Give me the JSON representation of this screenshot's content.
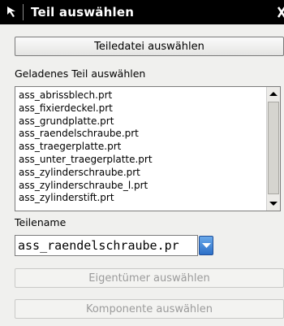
{
  "window": {
    "title": "Teil auswählen",
    "icon": "arrow-cursor-icon",
    "close_icon": "close-icon"
  },
  "buttons": {
    "select_part_file": "Teiledatei auswählen",
    "select_owner": "Eigentümer auswählen",
    "select_component": "Komponente auswählen"
  },
  "loaded_parts": {
    "label": "Geladenes Teil auswählen",
    "items": [
      "ass_abrissblech.prt",
      "ass_fixierdeckel.prt",
      "ass_grundplatte.prt",
      "ass_raendelschraube.prt",
      "ass_traegerplatte.prt",
      "ass_unter_traegerplatte.prt",
      "ass_zylinderschraube.prt",
      "ass_zylinderschraube_l.prt",
      "ass_zylinderstift.prt"
    ]
  },
  "part_name": {
    "label": "Teilename",
    "value": "ass_raendelschraube.pr"
  },
  "colors": {
    "title_bg": "#000000",
    "dialog_bg": "#f0f0ee",
    "dropdown_accent": "#2c6fc7"
  }
}
